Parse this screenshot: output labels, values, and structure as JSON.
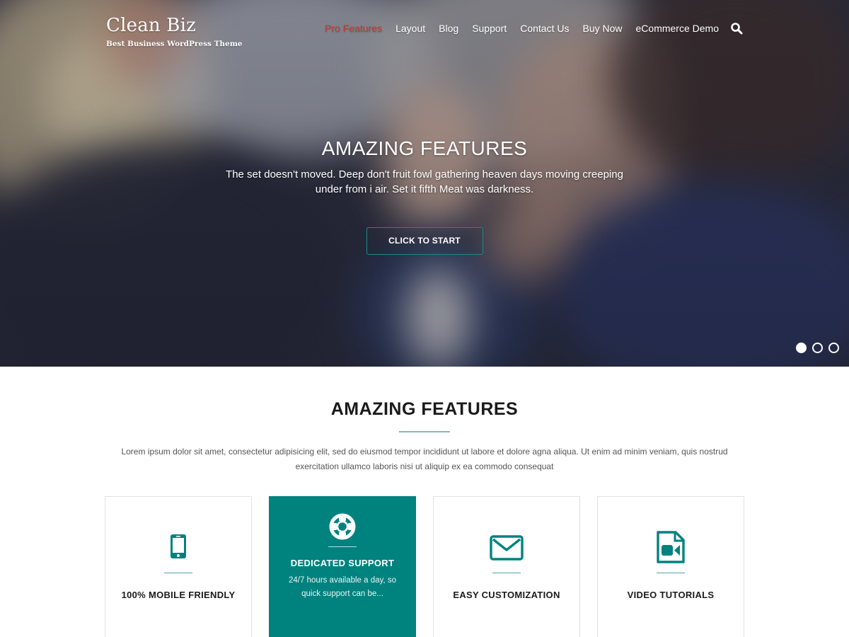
{
  "site": {
    "title": "Clean Biz",
    "tagline": "Best Business WordPress Theme"
  },
  "nav": {
    "items": [
      {
        "label": "Pro Features",
        "active": true
      },
      {
        "label": "Layout",
        "active": false
      },
      {
        "label": "Blog",
        "active": false
      },
      {
        "label": "Support",
        "active": false
      },
      {
        "label": "Contact Us",
        "active": false
      },
      {
        "label": "Buy Now",
        "active": false
      },
      {
        "label": "eCommerce Demo",
        "active": false
      }
    ],
    "search_icon": "search-icon"
  },
  "hero": {
    "title": "AMAZING FEATURES",
    "text": "The set doesn't moved. Deep don't fruit fowl gathering heaven days moving creeping under from i air. Set it fifth Meat was darkness.",
    "button_label": "CLICK TO START",
    "slides_total": 3,
    "active_slide": 1
  },
  "features": {
    "title": "AMAZING FEATURES",
    "description": "Lorem ipsum dolor sit amet, consectetur adipisicing elit, sed do eiusmod tempor incididunt ut labore et dolore agna aliqua. Ut enim ad minim veniam, quis nostrud exercitation ullamco laboris nisi ut aliquip ex ea commodo consequat",
    "cards": [
      {
        "icon": "mobile-phone-icon",
        "title": "100% MOBILE FRIENDLY",
        "text": "",
        "highlighted": false
      },
      {
        "icon": "life-ring-icon",
        "title": "DEDICATED SUPPORT",
        "text": "24/7 hours available a day, so quick support can be...",
        "highlighted": true
      },
      {
        "icon": "envelope-icon",
        "title": "EASY CUSTOMIZATION",
        "text": "",
        "highlighted": false
      },
      {
        "icon": "file-video-icon",
        "title": "VIDEO TUTORIALS",
        "text": "",
        "highlighted": false
      }
    ]
  },
  "colors": {
    "accent": "#00827f",
    "nav_active": "#c0392b",
    "rule": "#7fbcbc",
    "heading": "#1a1a1a",
    "body_text": "#555555"
  }
}
